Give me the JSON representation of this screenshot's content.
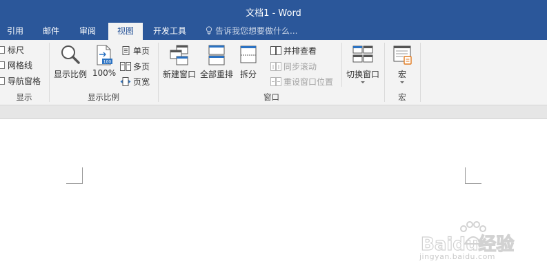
{
  "window": {
    "title": "文档1 - Word"
  },
  "tabs": [
    {
      "label": "引用",
      "active": false
    },
    {
      "label": "邮件",
      "active": false
    },
    {
      "label": "审阅",
      "active": false
    },
    {
      "label": "视图",
      "active": true
    },
    {
      "label": "开发工具",
      "active": false
    }
  ],
  "tell_me": {
    "placeholder": "告诉我您想要做什么..."
  },
  "ribbon": {
    "show": {
      "label": "显示",
      "checkboxes": [
        {
          "label": "标尺",
          "checked": false
        },
        {
          "label": "网格线",
          "checked": false
        },
        {
          "label": "导航窗格",
          "checked": false
        }
      ]
    },
    "zoom": {
      "label": "显示比例",
      "zoom_button": "显示比例",
      "hundred_button": "100%",
      "one_page": "单页",
      "multi_page": "多页",
      "page_width": "页宽"
    },
    "window": {
      "label": "窗口",
      "new_window": "新建窗口",
      "arrange_all": "全部重排",
      "split": "拆分",
      "side_by_side": "并排查看",
      "sync_scroll": "同步滚动",
      "reset_position": "重设窗口位置",
      "switch_windows": "切换窗口"
    },
    "macros": {
      "label": "宏",
      "macros_button": "宏"
    }
  },
  "watermark": {
    "brand": "Baidu经验",
    "url": "jingyan.baidu.com"
  },
  "colors": {
    "accent": "#2b579a",
    "ribbon_bg": "#f3f3f3",
    "doc_bg": "#e6e6e6"
  }
}
